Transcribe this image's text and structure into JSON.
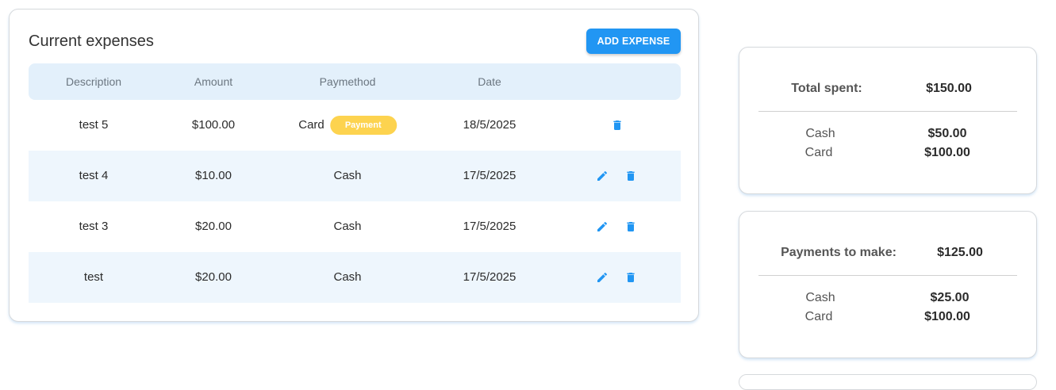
{
  "expenses": {
    "title": "Current expenses",
    "add_button": "ADD EXPENSE",
    "columns": [
      "Description",
      "Amount",
      "Paymethod",
      "Date"
    ],
    "rows": [
      {
        "description": "test 5",
        "amount": "$100.00",
        "paymethod": "Card",
        "badge": "Payment",
        "date": "18/5/2025",
        "editable": false
      },
      {
        "description": "test 4",
        "amount": "$10.00",
        "paymethod": "Cash",
        "badge": "",
        "date": "17/5/2025",
        "editable": true
      },
      {
        "description": "test 3",
        "amount": "$20.00",
        "paymethod": "Cash",
        "badge": "",
        "date": "17/5/2025",
        "editable": true
      },
      {
        "description": "test",
        "amount": "$20.00",
        "paymethod": "Cash",
        "badge": "",
        "date": "17/5/2025",
        "editable": true
      }
    ]
  },
  "total_spent": {
    "label": "Total spent:",
    "value": "$150.00",
    "breakdown": [
      {
        "label": "Cash",
        "value": "$50.00"
      },
      {
        "label": "Card",
        "value": "$100.00"
      }
    ]
  },
  "payments_to_make": {
    "label": "Payments to make:",
    "value": "$125.00",
    "breakdown": [
      {
        "label": "Cash",
        "value": "$25.00"
      },
      {
        "label": "Card",
        "value": "$100.00"
      }
    ]
  },
  "icons": {
    "edit": "pencil-icon",
    "delete": "trash-icon"
  },
  "colors": {
    "accent": "#2196f3",
    "badge": "#fdd34f",
    "header_bg": "#e3f0fb",
    "alt_row_bg": "#eef6fd"
  }
}
